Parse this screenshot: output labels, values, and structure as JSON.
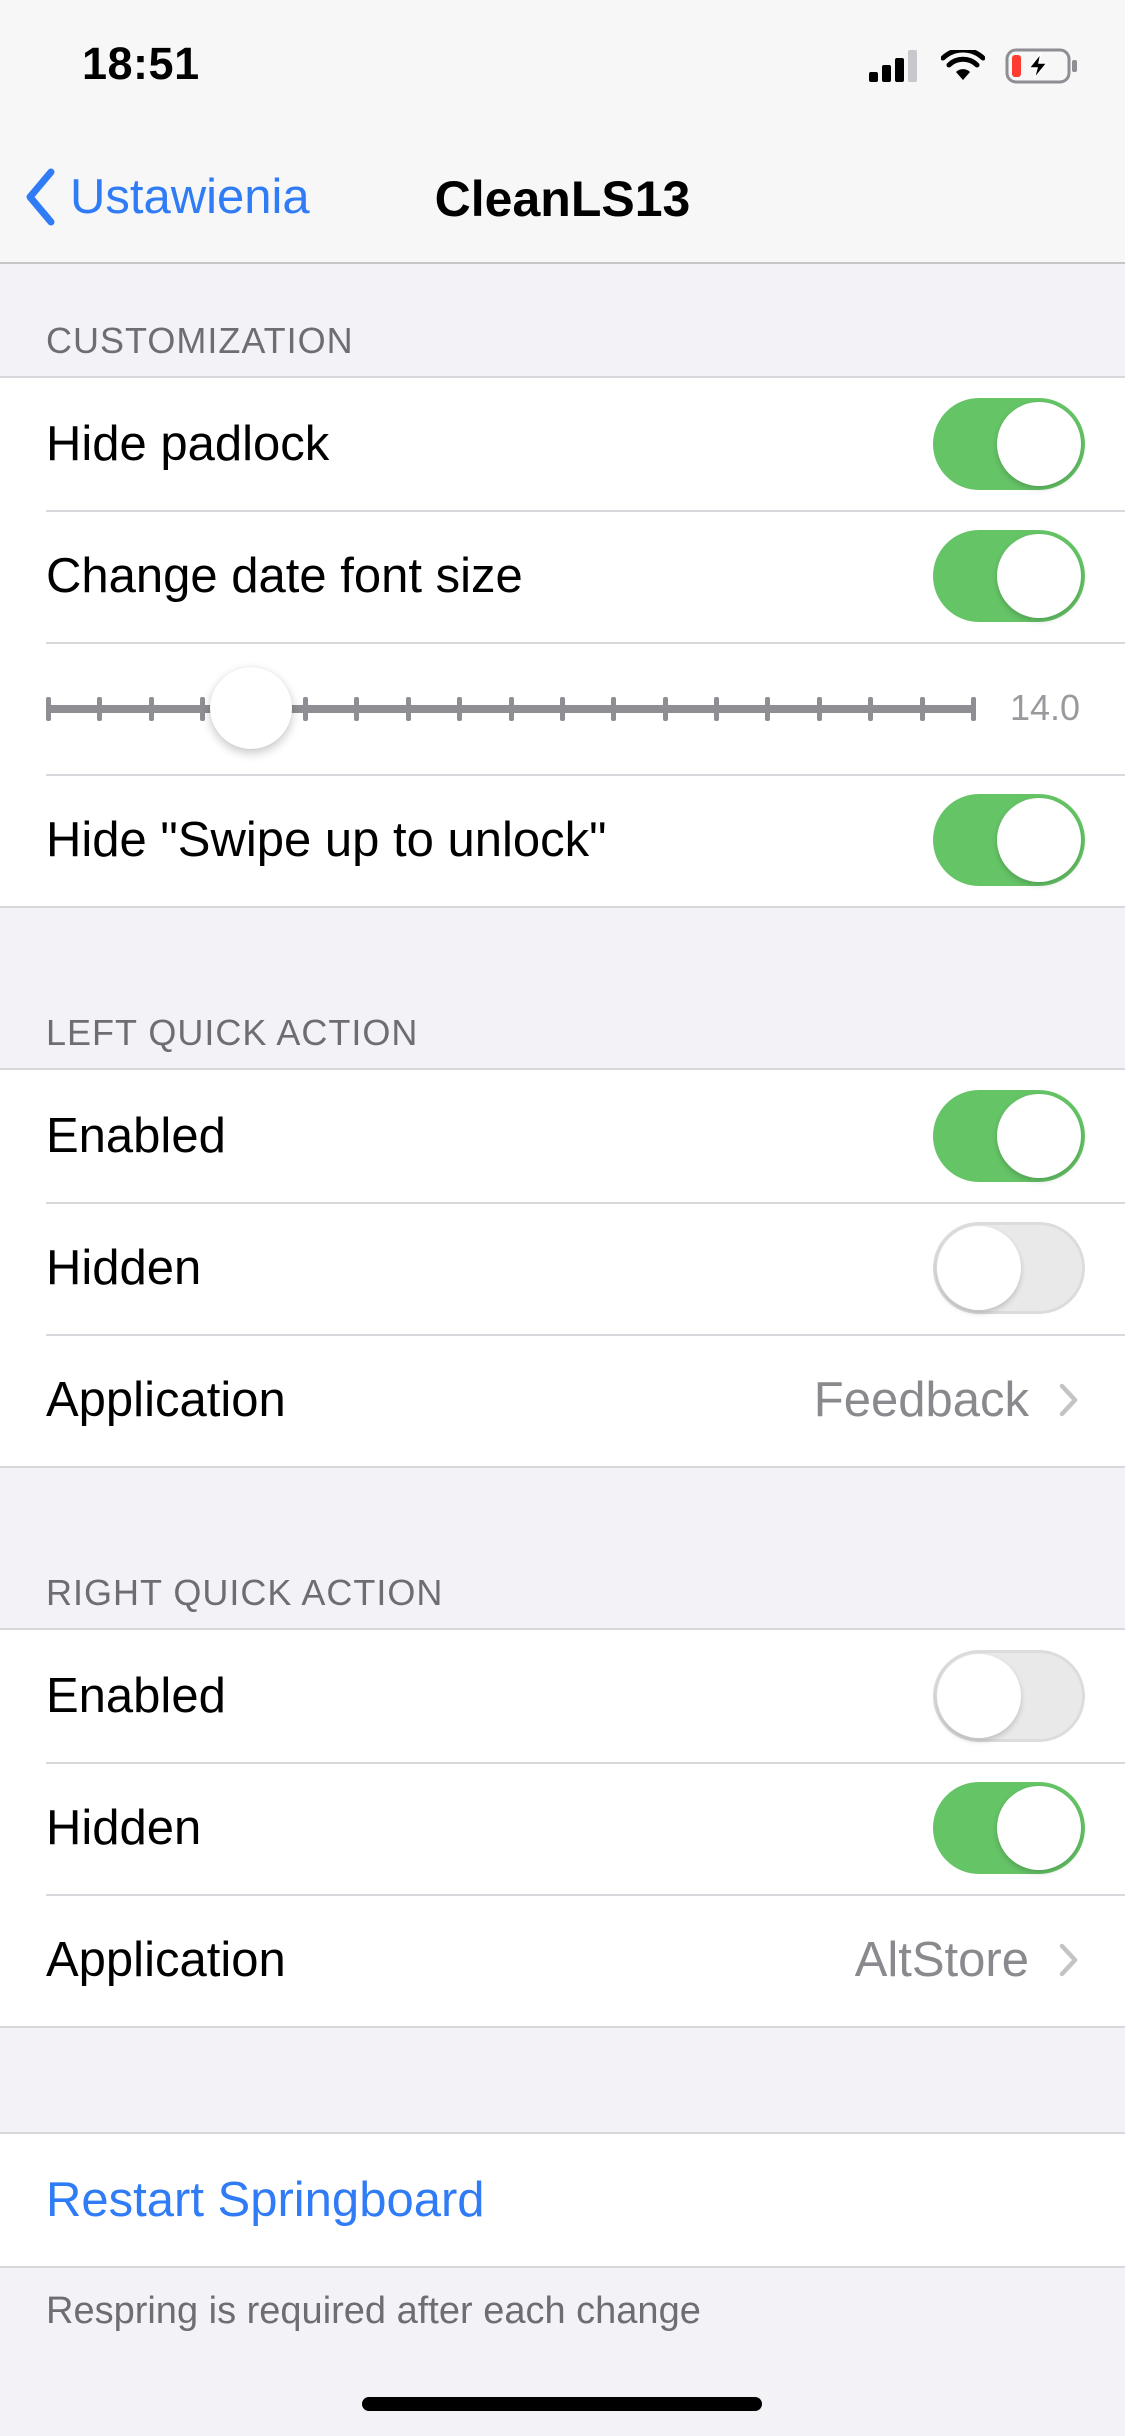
{
  "status_bar": {
    "time": "18:51",
    "icons": [
      "cellular-signal-icon",
      "wifi-icon",
      "battery-charging-icon"
    ],
    "battery_color": "#ff3b30"
  },
  "nav": {
    "back_label": "Ustawienia",
    "title": "CleanLS13",
    "accent_color": "#2f7cf6"
  },
  "sections": {
    "customization": {
      "header": "CUSTOMIZATION",
      "hide_padlock": {
        "label": "Hide padlock",
        "on": true
      },
      "change_date_font_size": {
        "label": "Change date font size",
        "on": true
      },
      "font_size_slider": {
        "value_label": "14.0",
        "position": 0.22
      },
      "hide_swipe_up": {
        "label": "Hide \"Swipe up to unlock\"",
        "on": true
      }
    },
    "left_quick_action": {
      "header": "LEFT QUICK ACTION",
      "enabled": {
        "label": "Enabled",
        "on": true
      },
      "hidden": {
        "label": "Hidden",
        "on": false
      },
      "application": {
        "label": "Application",
        "value": "Feedback"
      }
    },
    "right_quick_action": {
      "header": "RIGHT QUICK ACTION",
      "enabled": {
        "label": "Enabled",
        "on": false
      },
      "hidden": {
        "label": "Hidden",
        "on": true
      },
      "application": {
        "label": "Application",
        "value": "AltStore"
      }
    }
  },
  "respring": {
    "button_label": "Restart Springboard",
    "note": "Respring is required after each change"
  },
  "colors": {
    "toggle_on": "#65c466",
    "toggle_off": "#e9e9ea",
    "background": "#f2f2f7"
  }
}
